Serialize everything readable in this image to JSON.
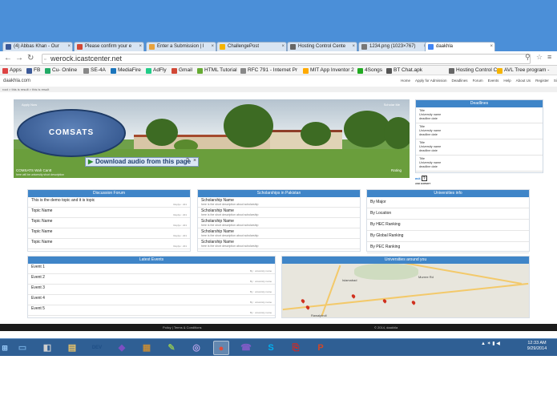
{
  "browser": {
    "tabs": [
      {
        "label": "(4) Abbas Khan - Our",
        "icon_color": "#3b5998"
      },
      {
        "label": "Please confirm your e",
        "icon_color": "#d14836"
      },
      {
        "label": "Enter a Submission | I",
        "icon_color": "#e8a33d"
      },
      {
        "label": "ChallengePost",
        "icon_color": "#f5b400"
      },
      {
        "label": "Hosting Control Cente",
        "icon_color": "#666666"
      },
      {
        "label": "1234.png (1023×767)",
        "icon_color": "#777777"
      },
      {
        "label": "daakhla",
        "icon_color": "#4285f4"
      }
    ],
    "active_tab": 6,
    "url": "werock.icastcenter.net",
    "bookmarks": [
      {
        "label": "Apps",
        "icon_color": "#d44"
      },
      {
        "label": "FB",
        "icon_color": "#3b5998"
      },
      {
        "label": "Cu- Online",
        "icon_color": "#2a6"
      },
      {
        "label": "SE-4A",
        "icon_color": "#888"
      },
      {
        "label": "MediaFire",
        "icon_color": "#1b75bc"
      },
      {
        "label": "AdFly",
        "icon_color": "#2c8"
      },
      {
        "label": "Gmail",
        "icon_color": "#d14836"
      },
      {
        "label": "HTML Tutorial",
        "icon_color": "#6a3"
      },
      {
        "label": "RFC 791 - Internet Pr",
        "icon_color": "#888"
      },
      {
        "label": "MIT App Inventor 2",
        "icon_color": "#fa0"
      },
      {
        "label": "4Songs",
        "icon_color": "#2a2"
      },
      {
        "label": "BT Chat.apk",
        "icon_color": "#555"
      },
      {
        "label": "Hosting Control Ce",
        "icon_color": "#666"
      },
      {
        "label": "AVL Tree program -",
        "icon_color": "#f5b400"
      }
    ]
  },
  "site": {
    "logo": "daakhla.com",
    "nav": [
      "Home",
      "Apply for Admission",
      "Deadlines",
      "Forum",
      "Events",
      "Help",
      "About Us",
      "Register",
      "Sign In"
    ],
    "breadcrumb": "root > this is result > this is result",
    "hero": {
      "left_tag": "Apply Now",
      "right_tag": "Scholar Me",
      "logo_text": "COMSATS",
      "caption": "COMSATS Wah Cantt",
      "subcaption": "here will be university short description",
      "rating": "Rating"
    },
    "download_bar": {
      "label": "Download audio from this page",
      "help": "?",
      "close": "×"
    },
    "deadlines": {
      "title": "Deadlines",
      "items": [
        {
          "title": "Title",
          "name": "University name",
          "date": "deadline date"
        },
        {
          "title": "Title",
          "name": "University name",
          "date": "deadline date"
        },
        {
          "title": "Title",
          "name": "University name",
          "date": "deadline date"
        },
        {
          "title": "Title",
          "name": "University name",
          "date": "deadline date"
        }
      ]
    },
    "ask_expert": "ASK EXPERT",
    "discussion": {
      "title": "Discussion Forum",
      "rows": [
        {
          "title": "This is the demo topic and it is topic",
          "meta": "Replys : 221"
        },
        {
          "title": "Topic Name",
          "meta": "Replys : 221"
        },
        {
          "title": "Topic Name",
          "meta": "Replys : 221"
        },
        {
          "title": "Topic Name",
          "meta": "Replys : 221"
        },
        {
          "title": "Topic Name",
          "meta": "Replys : 221"
        }
      ]
    },
    "scholarships": {
      "title": "Scholarships in Pakistan",
      "rows": [
        {
          "title": "Scholarship Name",
          "desc": "here is the short description about scholarship"
        },
        {
          "title": "Scholarship Name",
          "desc": "here is the short description about scholarship"
        },
        {
          "title": "Scholarship Name",
          "desc": "here is the short description about scholarship"
        },
        {
          "title": "Scholarship Name",
          "desc": "here is the short description about scholarship"
        },
        {
          "title": "Scholarship Name",
          "desc": "here is the short description about scholarship"
        }
      ]
    },
    "universities_info": {
      "title": "Universities info",
      "rows": [
        "By Major",
        "By Location",
        "By HEC Ranking",
        "By Global Ranking",
        "By PEC Ranking"
      ]
    },
    "events": {
      "title": "Latest Events",
      "rows": [
        {
          "title": "Event 1",
          "meta": "By : university name"
        },
        {
          "title": "Event 2",
          "meta": "By : university name"
        },
        {
          "title": "Event 3",
          "meta": "By : university name"
        },
        {
          "title": "Event 4",
          "meta": "By : university name"
        },
        {
          "title": "Event 5",
          "meta": "By : university name"
        }
      ]
    },
    "universities_around": {
      "title": "Universities around you",
      "map_labels": [
        "Islamabad",
        "Rawalpindi",
        "Murree Rd"
      ]
    },
    "footer": {
      "left": "Policy | Terms & Conditions",
      "right": "© 2014, daakhla"
    }
  },
  "taskbar": {
    "items": [
      {
        "glyph": "▭",
        "color": "#6fa8dc",
        "name": "explorer"
      },
      {
        "glyph": "◧",
        "color": "#cfcfcf",
        "name": "computer"
      },
      {
        "glyph": "▤",
        "color": "#e8c36a",
        "name": "folder"
      },
      {
        "glyph": "DEV",
        "color": "#1f4f86",
        "name": "devcpp"
      },
      {
        "glyph": "◆",
        "color": "#7d4fc2",
        "name": "visual-studio"
      },
      {
        "glyph": "▦",
        "color": "#c08a3a",
        "name": "winrar"
      },
      {
        "glyph": "✎",
        "color": "#8bbf5a",
        "name": "paint"
      },
      {
        "glyph": "◎",
        "color": "#b6a3e8",
        "name": "app"
      },
      {
        "glyph": "●",
        "color": "#e04a3a",
        "name": "chrome"
      },
      {
        "glyph": "☎",
        "color": "#7c5cc4",
        "name": "viber"
      },
      {
        "glyph": "S",
        "color": "#00aff0",
        "name": "skype"
      },
      {
        "glyph": "⎘",
        "color": "#d9281e",
        "name": "acrobat"
      },
      {
        "glyph": "P",
        "color": "#d24726",
        "name": "powerpoint"
      }
    ],
    "active_item": 8,
    "tray_icons": "▲ ✶ ▮ ◀",
    "time": "12:33 AM",
    "date": "9/29/2014"
  }
}
